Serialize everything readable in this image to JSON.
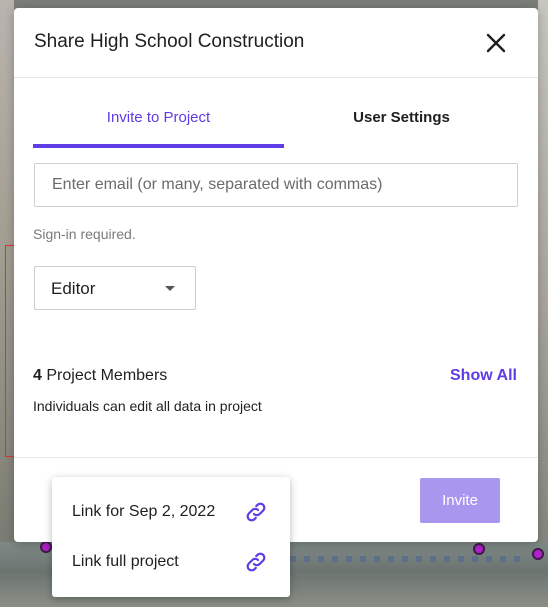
{
  "modal": {
    "title": "Share High School Construction",
    "close_icon": "close-icon"
  },
  "tabs": [
    {
      "label": "Invite to Project",
      "active": true
    },
    {
      "label": "User Settings",
      "active": false
    }
  ],
  "invite_form": {
    "email_placeholder": "Enter email (or many, separated with commas)",
    "email_value": "",
    "hint": "Sign-in required.",
    "role_selected": "Editor"
  },
  "members": {
    "count": "4",
    "label": "Project Members",
    "show_all_label": "Show All",
    "description": "Individuals can edit all data in project"
  },
  "footer": {
    "invite_label": "Invite"
  },
  "link_menu": {
    "items": [
      {
        "label": "Link for Sep 2, 2022",
        "icon": "link-icon"
      },
      {
        "label": "Link full project",
        "icon": "link-icon"
      }
    ]
  },
  "colors": {
    "accent": "#5e3ce6",
    "invite_button_disabled": "#a997ef",
    "marker": "#b51fd0"
  }
}
